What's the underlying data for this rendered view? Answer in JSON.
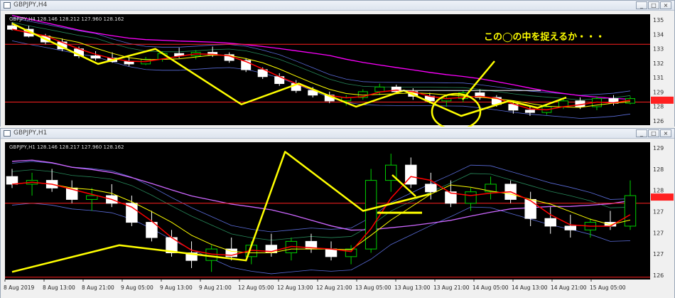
{
  "windows": {
    "h4": {
      "title": "GBPJPY,H4",
      "info": "GBPJPY,H4  128.146 128.212 127.960 128.162",
      "annotation": "この◯の中を捉えるか・・・",
      "price_labels": [
        "135",
        "134",
        "133",
        "132",
        "131",
        "129",
        "128",
        "126"
      ],
      "controls": [
        "_",
        "□",
        "×"
      ]
    },
    "h1": {
      "title": "GBPJPY,H1",
      "info": "GBPJPY,H1  128.146 128.217 127.960 128.162",
      "price_labels": [
        "129",
        "128",
        "128",
        "127",
        "127",
        "127",
        "126"
      ],
      "controls": [
        "_",
        "□",
        "×"
      ]
    }
  },
  "time_axis": [
    "8 Aug 2019",
    "8 Aug 13:00",
    "8 Aug 21:00",
    "9 Aug 05:00",
    "9 Aug 13:00",
    "9 Aug 21:00",
    "12 Aug 05:00",
    "12 Aug 13:00",
    "12 Aug 21:00",
    "13 Aug 05:00",
    "13 Aug 13:00",
    "13 Aug 21:00",
    "14 Aug 05:00",
    "14 Aug 13:00",
    "14 Aug 21:00",
    "15 Aug 05:00"
  ],
  "colors": {
    "background": "#000000",
    "bull": "#00d000",
    "bear": "#ffffff",
    "ma_red": "#ff0000",
    "ma_yellow": "#ffff00",
    "ma_magenta": "#ff00ff",
    "ma_violet": "#cc66ff",
    "band": "#6a7fff",
    "band_green": "#2ea06a",
    "level_line": "#ff2020",
    "annotation": "#ffff00"
  },
  "chart_data": [
    {
      "type": "candlestick",
      "symbol": "GBPJPY",
      "timeframe": "H4",
      "ylim": [
        126,
        135.6
      ],
      "current_price": 128.162,
      "horizontal_levels": [
        133.0,
        128.0
      ],
      "resistance_line": 129.0,
      "zigzag_wave": [
        {
          "x": 0,
          "y": 134.8
        },
        {
          "x": 9,
          "y": 131.3
        },
        {
          "x": 15,
          "y": 132.6
        },
        {
          "x": 24,
          "y": 127.8
        },
        {
          "x": 30,
          "y": 129.6
        },
        {
          "x": 36,
          "y": 127.6
        },
        {
          "x": 41,
          "y": 129.0
        },
        {
          "x": 47,
          "y": 126.8
        },
        {
          "x": 52,
          "y": 128.1
        },
        {
          "x": 55,
          "y": 127.5
        },
        {
          "x": 58,
          "y": 128.4
        }
      ],
      "candles": [
        {
          "o": 134.6,
          "h": 134.9,
          "l": 134.2,
          "c": 134.3
        },
        {
          "o": 134.3,
          "h": 134.6,
          "l": 133.6,
          "c": 133.7
        },
        {
          "o": 133.7,
          "h": 133.9,
          "l": 133.0,
          "c": 133.2
        },
        {
          "o": 133.2,
          "h": 133.5,
          "l": 132.4,
          "c": 132.6
        },
        {
          "o": 132.6,
          "h": 132.8,
          "l": 131.8,
          "c": 132.0
        },
        {
          "o": 132.0,
          "h": 132.4,
          "l": 131.6,
          "c": 131.8
        },
        {
          "o": 131.8,
          "h": 132.3,
          "l": 131.4,
          "c": 131.5
        },
        {
          "o": 131.5,
          "h": 131.9,
          "l": 131.1,
          "c": 131.3
        },
        {
          "o": 131.3,
          "h": 131.9,
          "l": 131.2,
          "c": 131.7
        },
        {
          "o": 131.7,
          "h": 132.4,
          "l": 131.5,
          "c": 132.2
        },
        {
          "o": 132.2,
          "h": 132.7,
          "l": 131.8,
          "c": 132.0
        },
        {
          "o": 132.0,
          "h": 132.5,
          "l": 131.7,
          "c": 132.3
        },
        {
          "o": 132.3,
          "h": 132.8,
          "l": 131.9,
          "c": 132.1
        },
        {
          "o": 132.1,
          "h": 132.3,
          "l": 131.4,
          "c": 131.6
        },
        {
          "o": 131.6,
          "h": 131.8,
          "l": 130.6,
          "c": 130.8
        },
        {
          "o": 130.8,
          "h": 131.0,
          "l": 130.0,
          "c": 130.2
        },
        {
          "o": 130.2,
          "h": 130.5,
          "l": 129.4,
          "c": 129.6
        },
        {
          "o": 129.6,
          "h": 129.9,
          "l": 128.8,
          "c": 129.0
        },
        {
          "o": 129.0,
          "h": 129.3,
          "l": 128.4,
          "c": 128.6
        },
        {
          "o": 128.6,
          "h": 128.9,
          "l": 127.9,
          "c": 128.1
        },
        {
          "o": 128.1,
          "h": 128.6,
          "l": 127.7,
          "c": 128.4
        },
        {
          "o": 128.4,
          "h": 129.1,
          "l": 128.2,
          "c": 128.9
        },
        {
          "o": 128.9,
          "h": 129.6,
          "l": 128.6,
          "c": 129.3
        },
        {
          "o": 129.3,
          "h": 129.5,
          "l": 128.7,
          "c": 128.9
        },
        {
          "o": 128.9,
          "h": 129.2,
          "l": 128.2,
          "c": 128.5
        },
        {
          "o": 128.5,
          "h": 128.8,
          "l": 127.9,
          "c": 128.1
        },
        {
          "o": 128.1,
          "h": 128.5,
          "l": 127.6,
          "c": 128.3
        },
        {
          "o": 128.3,
          "h": 129.0,
          "l": 128.0,
          "c": 128.8
        },
        {
          "o": 128.8,
          "h": 129.1,
          "l": 128.2,
          "c": 128.4
        },
        {
          "o": 128.4,
          "h": 128.6,
          "l": 127.6,
          "c": 127.8
        },
        {
          "o": 127.8,
          "h": 128.1,
          "l": 127.0,
          "c": 127.3
        },
        {
          "o": 127.3,
          "h": 127.6,
          "l": 126.8,
          "c": 127.1
        },
        {
          "o": 127.1,
          "h": 127.8,
          "l": 126.9,
          "c": 127.6
        },
        {
          "o": 127.6,
          "h": 128.3,
          "l": 127.4,
          "c": 128.1
        },
        {
          "o": 128.1,
          "h": 128.4,
          "l": 127.4,
          "c": 127.6
        },
        {
          "o": 127.6,
          "h": 128.5,
          "l": 127.3,
          "c": 128.3
        },
        {
          "o": 128.3,
          "h": 128.6,
          "l": 127.7,
          "c": 127.9
        },
        {
          "o": 127.9,
          "h": 128.5,
          "l": 127.8,
          "c": 128.3
        }
      ]
    },
    {
      "type": "candlestick",
      "symbol": "GBPJPY",
      "timeframe": "H1",
      "ylim": [
        126.0,
        129.6
      ],
      "current_price": 128.162,
      "horizontal_levels": [
        128.0,
        126.06
      ],
      "support_line": 127.75,
      "zigzag_wave": [
        {
          "x": 0,
          "y": 126.2
        },
        {
          "x": 11,
          "y": 126.9
        },
        {
          "x": 24,
          "y": 126.5
        },
        {
          "x": 28,
          "y": 129.35
        },
        {
          "x": 36,
          "y": 127.8
        },
        {
          "x": 43,
          "y": 128.25
        }
      ],
      "candles": [
        {
          "o": 128.7,
          "h": 128.9,
          "l": 128.4,
          "c": 128.5
        },
        {
          "o": 128.5,
          "h": 128.8,
          "l": 128.2,
          "c": 128.6
        },
        {
          "o": 128.6,
          "h": 128.9,
          "l": 128.3,
          "c": 128.4
        },
        {
          "o": 128.4,
          "h": 128.6,
          "l": 128.0,
          "c": 128.1
        },
        {
          "o": 128.1,
          "h": 128.4,
          "l": 127.8,
          "c": 128.2
        },
        {
          "o": 128.2,
          "h": 128.5,
          "l": 127.9,
          "c": 128.0
        },
        {
          "o": 128.0,
          "h": 128.2,
          "l": 127.4,
          "c": 127.5
        },
        {
          "o": 127.5,
          "h": 127.8,
          "l": 127.0,
          "c": 127.1
        },
        {
          "o": 127.1,
          "h": 127.3,
          "l": 126.6,
          "c": 126.7
        },
        {
          "o": 126.7,
          "h": 127.0,
          "l": 126.3,
          "c": 126.5
        },
        {
          "o": 126.5,
          "h": 126.9,
          "l": 126.2,
          "c": 126.8
        },
        {
          "o": 126.8,
          "h": 127.1,
          "l": 126.5,
          "c": 126.6
        },
        {
          "o": 126.6,
          "h": 127.0,
          "l": 126.4,
          "c": 126.9
        },
        {
          "o": 126.9,
          "h": 127.2,
          "l": 126.6,
          "c": 126.7
        },
        {
          "o": 126.7,
          "h": 127.1,
          "l": 126.5,
          "c": 127.0
        },
        {
          "o": 127.0,
          "h": 127.2,
          "l": 126.7,
          "c": 126.8
        },
        {
          "o": 126.8,
          "h": 127.0,
          "l": 126.5,
          "c": 126.6
        },
        {
          "o": 126.6,
          "h": 126.9,
          "l": 126.4,
          "c": 126.8
        },
        {
          "o": 126.8,
          "h": 128.9,
          "l": 126.7,
          "c": 128.6
        },
        {
          "o": 128.6,
          "h": 129.3,
          "l": 128.3,
          "c": 129.0
        },
        {
          "o": 129.0,
          "h": 129.2,
          "l": 128.4,
          "c": 128.5
        },
        {
          "o": 128.5,
          "h": 128.8,
          "l": 128.1,
          "c": 128.3
        },
        {
          "o": 128.3,
          "h": 128.6,
          "l": 127.9,
          "c": 128.0
        },
        {
          "o": 128.0,
          "h": 128.4,
          "l": 127.8,
          "c": 128.3
        },
        {
          "o": 128.3,
          "h": 128.7,
          "l": 128.1,
          "c": 128.5
        },
        {
          "o": 128.5,
          "h": 128.6,
          "l": 128.0,
          "c": 128.1
        },
        {
          "o": 128.1,
          "h": 128.3,
          "l": 127.4,
          "c": 127.6
        },
        {
          "o": 127.6,
          "h": 127.9,
          "l": 127.2,
          "c": 127.4
        },
        {
          "o": 127.4,
          "h": 127.7,
          "l": 127.1,
          "c": 127.3
        },
        {
          "o": 127.3,
          "h": 127.6,
          "l": 127.1,
          "c": 127.5
        },
        {
          "o": 127.5,
          "h": 127.8,
          "l": 127.3,
          "c": 127.4
        },
        {
          "o": 127.4,
          "h": 128.6,
          "l": 127.3,
          "c": 128.2
        }
      ]
    }
  ]
}
